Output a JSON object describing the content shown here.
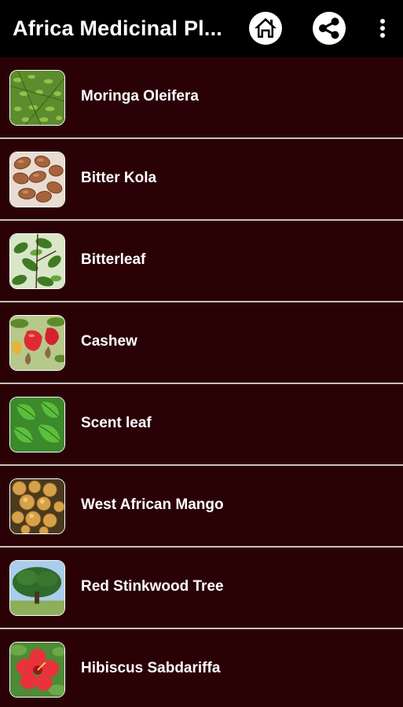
{
  "toolbar": {
    "title": "Africa Medicinal Pl...",
    "home_icon": "home-icon",
    "share_icon": "share-icon",
    "more_icon": "more-vertical-icon"
  },
  "colors": {
    "toolbar_bg": "#000000",
    "list_bg": "#2a0206",
    "divider": "#c9c0c0",
    "text": "#ffffff"
  },
  "plants": [
    {
      "name": "Moringa Oleifera",
      "thumb": "moringa-leaves"
    },
    {
      "name": "Bitter Kola",
      "thumb": "kola-nuts"
    },
    {
      "name": "Bitterleaf",
      "thumb": "bitterleaf-plant"
    },
    {
      "name": "Cashew",
      "thumb": "cashew-fruit"
    },
    {
      "name": "Scent leaf",
      "thumb": "scent-leaf"
    },
    {
      "name": "West African Mango",
      "thumb": "mango-fruits"
    },
    {
      "name": "Red Stinkwood Tree",
      "thumb": "stinkwood-tree"
    },
    {
      "name": "Hibiscus Sabdariffa",
      "thumb": "hibiscus-flower"
    }
  ]
}
